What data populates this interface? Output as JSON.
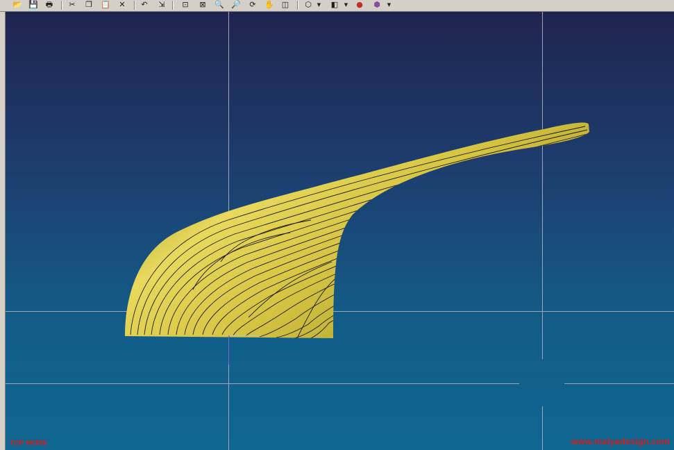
{
  "toolbar": {
    "buttons": [
      {
        "name": "open-file-icon",
        "glyph": "📂"
      },
      {
        "name": "save-icon",
        "glyph": "💾"
      },
      {
        "name": "print-icon",
        "glyph": "🖶"
      },
      {
        "name": "cut-icon",
        "glyph": "✂"
      },
      {
        "name": "copy-icon",
        "glyph": "❐"
      },
      {
        "name": "paste-icon",
        "glyph": "📋"
      },
      {
        "name": "delete-icon",
        "glyph": "✕"
      },
      {
        "name": "undo-icon",
        "glyph": "↶"
      },
      {
        "name": "snap-icon",
        "glyph": "⇲"
      },
      {
        "name": "fit-view-icon",
        "glyph": "⊡"
      },
      {
        "name": "zoom-window-icon",
        "glyph": "⊠"
      },
      {
        "name": "zoom-area-icon",
        "glyph": "🔍"
      },
      {
        "name": "zoom-icon",
        "glyph": "🔎"
      },
      {
        "name": "rotate-icon",
        "glyph": "⟳"
      },
      {
        "name": "pan-icon",
        "glyph": "✋"
      },
      {
        "name": "orient-icon",
        "glyph": "◫"
      },
      {
        "name": "view-cube-icon",
        "glyph": "⬡"
      },
      {
        "name": "shaded-cube-icon",
        "glyph": "◧"
      },
      {
        "name": "render-sphere-icon",
        "glyph": "●"
      },
      {
        "name": "wire-cube-icon",
        "glyph": "⬢"
      }
    ]
  },
  "viewport": {
    "view_label": "TOP WORK",
    "watermark": "www.maiyadesign.com",
    "model_color": "#d9c84a"
  }
}
